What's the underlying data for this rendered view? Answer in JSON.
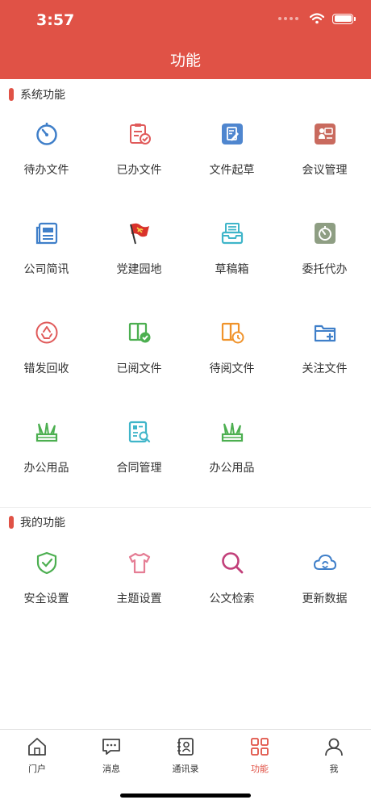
{
  "status_bar": {
    "time": "3:57"
  },
  "header": {
    "title": "功能"
  },
  "system_section": {
    "title": "系统功能",
    "items": [
      {
        "label": "待办文件",
        "icon": "timer-icon"
      },
      {
        "label": "已办文件",
        "icon": "clipboard-check-icon"
      },
      {
        "label": "文件起草",
        "icon": "document-edit-icon"
      },
      {
        "label": "会议管理",
        "icon": "meeting-icon"
      },
      {
        "label": "公司简讯",
        "icon": "newspaper-icon"
      },
      {
        "label": "党建园地",
        "icon": "party-flag-icon"
      },
      {
        "label": "草稿箱",
        "icon": "inbox-tray-icon"
      },
      {
        "label": "委托代办",
        "icon": "delegate-clock-icon"
      },
      {
        "label": "错发回收",
        "icon": "recycle-icon"
      },
      {
        "label": "已阅文件",
        "icon": "book-check-icon"
      },
      {
        "label": "待阅文件",
        "icon": "book-clock-icon"
      },
      {
        "label": "关注文件",
        "icon": "folder-add-icon"
      },
      {
        "label": "办公用品",
        "icon": "pencil-holder-icon"
      },
      {
        "label": "合同管理",
        "icon": "contract-search-icon"
      },
      {
        "label": "办公用品",
        "icon": "pencil-holder-icon"
      }
    ]
  },
  "my_section": {
    "title": "我的功能",
    "items": [
      {
        "label": "安全设置",
        "icon": "shield-check-icon"
      },
      {
        "label": "主题设置",
        "icon": "tshirt-icon"
      },
      {
        "label": "公文检索",
        "icon": "search-icon"
      },
      {
        "label": "更新数据",
        "icon": "cloud-refresh-icon"
      }
    ]
  },
  "tabbar": {
    "items": [
      {
        "label": "门户",
        "icon": "home-icon"
      },
      {
        "label": "消息",
        "icon": "message-icon"
      },
      {
        "label": "通讯录",
        "icon": "contacts-icon"
      },
      {
        "label": "功能",
        "icon": "grid-icon",
        "active": true
      },
      {
        "label": "我",
        "icon": "user-icon"
      }
    ]
  },
  "colors": {
    "brand": "#e05246",
    "blue": "#3f7fc9",
    "red": "#e05a5a",
    "teal": "#3fb5c9",
    "green": "#4caf50",
    "orange": "#f0932b",
    "olive": "#8e9e83",
    "brown": "#c96a5e",
    "pink": "#e57d94",
    "purple": "#c2407a"
  }
}
